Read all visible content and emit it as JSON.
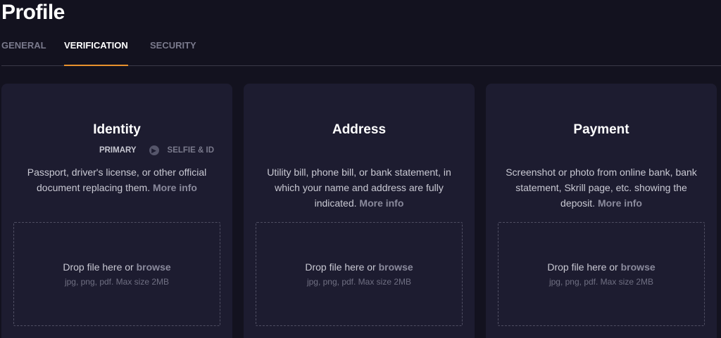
{
  "page": {
    "title": "Profile"
  },
  "tabs": [
    {
      "label": "GENERAL",
      "active": false
    },
    {
      "label": "VERIFICATION",
      "active": true
    },
    {
      "label": "SECURITY",
      "active": false
    }
  ],
  "colors": {
    "accent": "#e8912d",
    "background": "#13121f",
    "card": "#1d1c30"
  },
  "cards": [
    {
      "title": "Identity",
      "steps": {
        "primary": "PRIMARY",
        "secondary": "SELFIE & ID",
        "arrow_icon": "chevron-right-icon"
      },
      "description": "Passport, driver's license, or other official document replacing them.",
      "more_info": "More info",
      "drop_text": "Drop file here or",
      "browse": "browse",
      "hint": "jpg, png, pdf. Max size 2MB"
    },
    {
      "title": "Address",
      "description": "Utility bill, phone bill, or bank statement, in which your name and address are fully indicated.",
      "more_info": "More info",
      "drop_text": "Drop file here or",
      "browse": "browse",
      "hint": "jpg, png, pdf. Max size 2MB"
    },
    {
      "title": "Payment",
      "description": "Screenshot or photo from online bank, bank statement, Skrill page, etc. showing the deposit.",
      "more_info": "More info",
      "drop_text": "Drop file here or",
      "browse": "browse",
      "hint": "jpg, png, pdf. Max size 2MB"
    }
  ]
}
